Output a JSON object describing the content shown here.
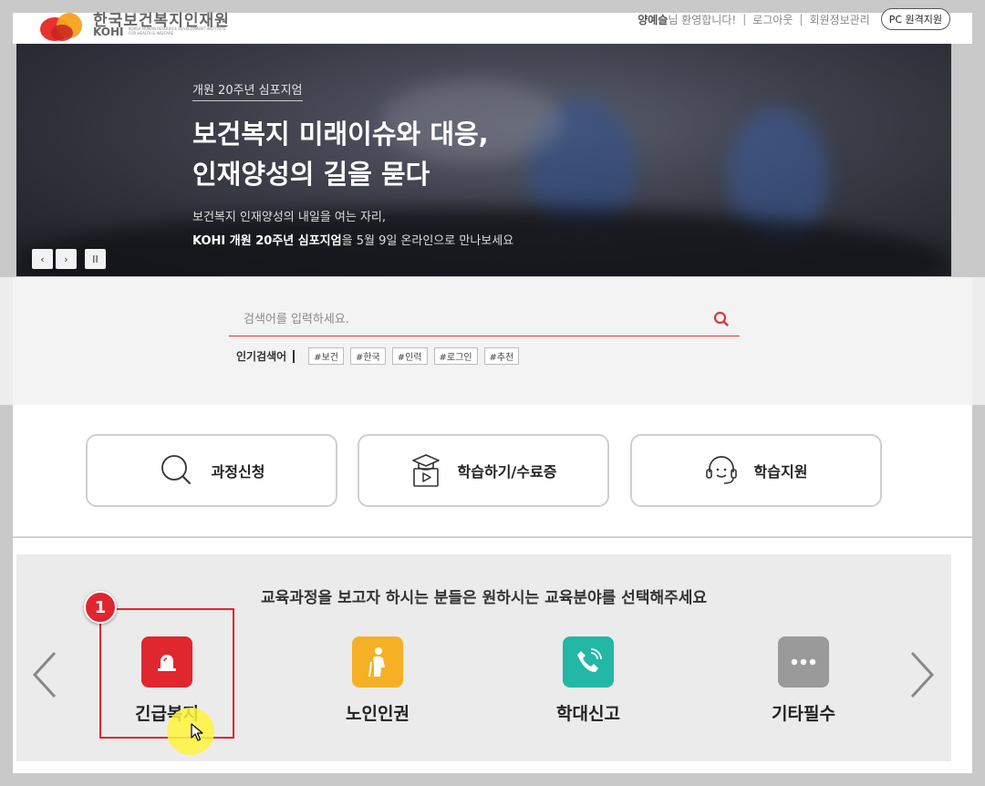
{
  "header": {
    "logo_kr": "한국보건복지인재원",
    "logo_en": "KOHI",
    "logo_en_sub": "KOREA HUMAN RESOURCE DEVELOPMENT INSTITUTE FOR HEALTH & WELFARE",
    "welcome_name": "양예슬",
    "welcome_suffix": "님 환영합니다!",
    "logout": "로그아웃",
    "member_info": "회원정보관리",
    "pc_support": "PC 원격지원"
  },
  "hero": {
    "tag": "개원 20주년 심포지엄",
    "title_line1": "보건복지 미래이슈와 대응,",
    "title_line2": "인재양성의 길을 묻다",
    "desc_line1": "보건복지 인재양성의 내일을 여는 자리,",
    "desc_bold": "KOHI 개원 20주년 심포지엄",
    "desc_rest": "을 5월 9일 온라인으로 만나보세요",
    "prev": "‹",
    "next": "›",
    "pause": "II"
  },
  "search": {
    "placeholder": "검색어를 입력하세요.",
    "popular_label": "인기검색어",
    "tags": [
      "#보건",
      "#한국",
      "#인력",
      "#로그인",
      "#추천"
    ]
  },
  "quick_menu": [
    {
      "label": "과정신청",
      "icon": "search-icon"
    },
    {
      "label": "학습하기/수료증",
      "icon": "certificate-icon"
    },
    {
      "label": "학습지원",
      "icon": "headset-icon"
    }
  ],
  "categories": {
    "heading": "교육과정을 보고자 하시는 분들은 원하시는 교육분야를 선택해주세요",
    "items": [
      {
        "label": "긴급복지",
        "icon": "alarm-bell-icon",
        "color": "#e0262f"
      },
      {
        "label": "노인인권",
        "icon": "elderly-person-icon",
        "color": "#f5b025"
      },
      {
        "label": "학대신고",
        "icon": "phone-call-icon",
        "color": "#23b7a6"
      },
      {
        "label": "기타필수",
        "icon": "more-dots-icon",
        "color": "#9a9a9a"
      }
    ]
  },
  "annotation": {
    "step_number": "1"
  }
}
